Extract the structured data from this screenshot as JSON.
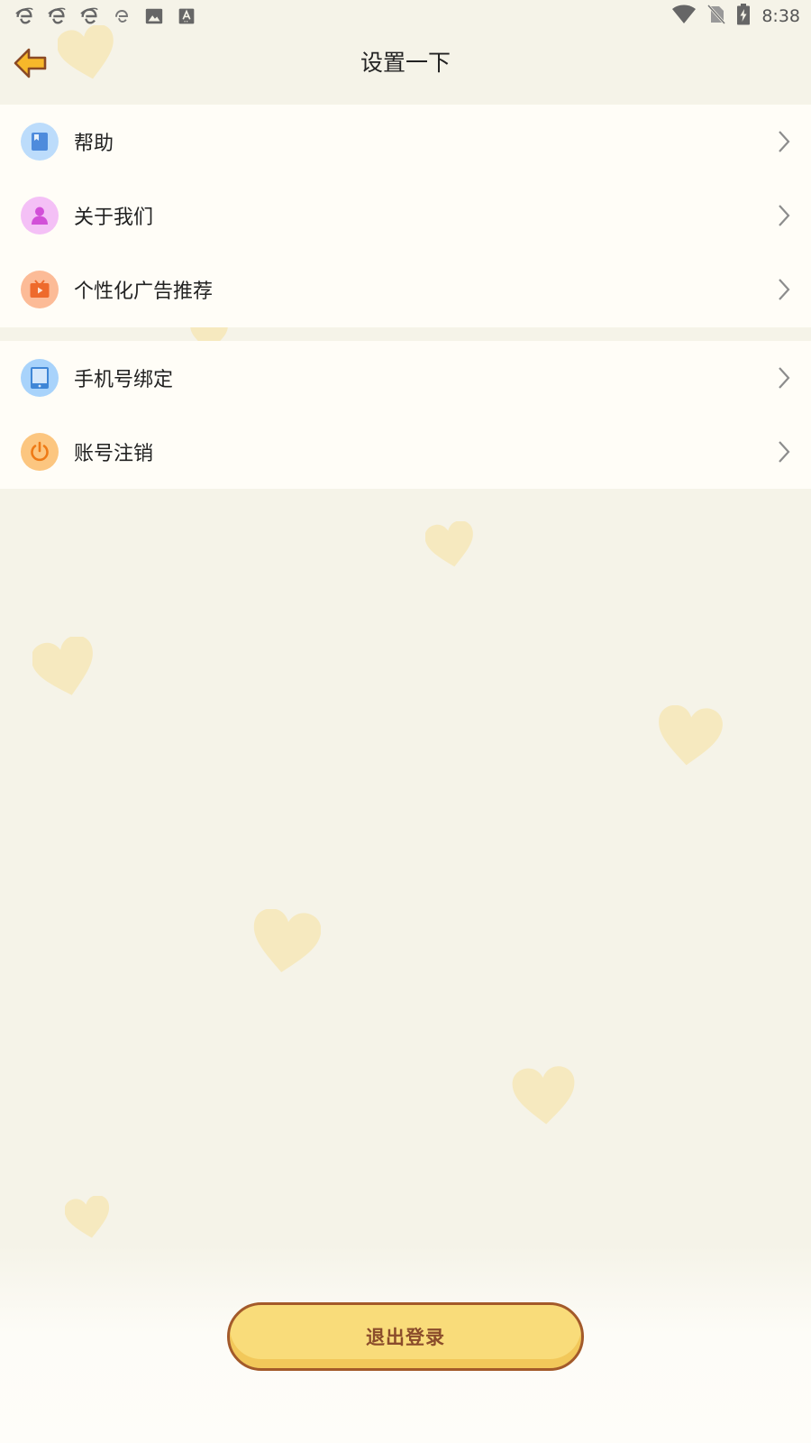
{
  "status_bar": {
    "time": "8:38",
    "left_icons": [
      "ie-browser-icon",
      "ie-browser-icon",
      "ie-browser-icon",
      "ie-browser-icon",
      "image-icon",
      "text-format-icon"
    ],
    "right_icons": [
      "wifi-icon",
      "no-sim-icon",
      "battery-charging-icon"
    ]
  },
  "header": {
    "title": "设置一下",
    "back_icon": "back-arrow-icon"
  },
  "settings": {
    "group1": [
      {
        "label": "帮助",
        "icon": "book-icon",
        "color": "#4e8bdc"
      },
      {
        "label": "关于我们",
        "icon": "person-icon",
        "color": "#d24fd8"
      },
      {
        "label": "个性化广告推荐",
        "icon": "tv-play-icon",
        "color": "#ee6a2c"
      }
    ],
    "group2": [
      {
        "label": "手机号绑定",
        "icon": "tablet-icon",
        "color": "#3f86d6"
      },
      {
        "label": "账号注销",
        "icon": "power-icon",
        "color": "#ee7a16"
      }
    ]
  },
  "logout": {
    "label": "退出登录"
  },
  "colors": {
    "background": "#f5f3e8",
    "card": "#fffdf7",
    "accent": "#f9dc7a",
    "accent_border": "#a35a2a",
    "heart": "#f6e9bf"
  }
}
